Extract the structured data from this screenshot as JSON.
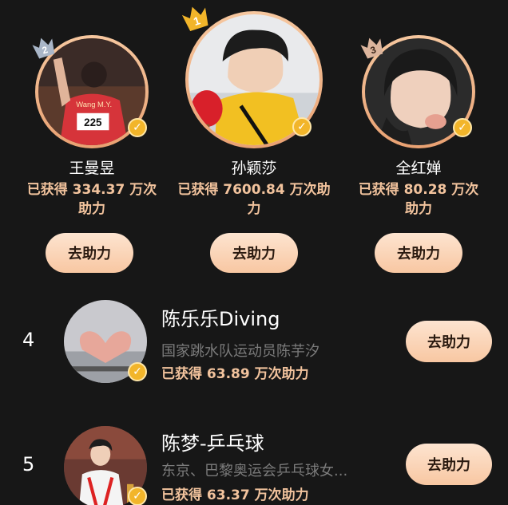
{
  "podium": [
    {
      "rank": "2",
      "name": "王曼昱",
      "score_line1": "已获得 334.37 万次",
      "score_line2": "助力",
      "jersey": "225",
      "shirt_text": "Wang M.Y.",
      "button": "去助力"
    },
    {
      "rank": "1",
      "name": "孙颖莎",
      "score_line1": "已获得 7600.84 万次助",
      "score_line2": "力",
      "button": "去助力"
    },
    {
      "rank": "3",
      "name": "全红婵",
      "score_line1": "已获得 80.28 万次",
      "score_line2": "助力",
      "button": "去助力"
    }
  ],
  "list": [
    {
      "rank": "4",
      "title": "陈乐乐Diving",
      "desc": "国家跳水队运动员陈芋汐",
      "score": "已获得 63.89 万次助力",
      "button": "去助力"
    },
    {
      "rank": "5",
      "title": "陈梦-乒乓球",
      "desc": "东京、巴黎奥运会乒乓球女...",
      "score": "已获得 63.37 万次助力",
      "button": "去助力"
    }
  ],
  "icons": {
    "verified": "verified-check-icon",
    "rank_crown": "crown-badge-icon"
  },
  "colors": {
    "background": "#171717",
    "accent_text": "#f2c39d",
    "button_bg": "#f8c7a2",
    "gold_badge": "#f2b52a",
    "silver_badge": "#a9b6c8",
    "bronze_badge": "#dcb59d"
  }
}
